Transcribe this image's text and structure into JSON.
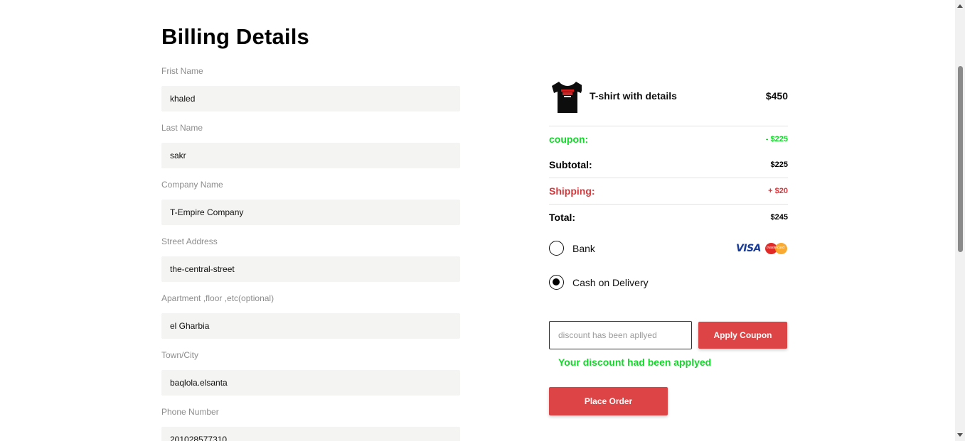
{
  "billing": {
    "title": "Billing Details",
    "fields": [
      {
        "label": "Frist Name",
        "value": "khaled"
      },
      {
        "label": "Last Name",
        "value": "sakr"
      },
      {
        "label": "Company Name",
        "value": "T-Empire Company"
      },
      {
        "label": "Street Address",
        "value": "the-central-street"
      },
      {
        "label": "Apartment ,floor ,etc(optional)",
        "value": "el Gharbia"
      },
      {
        "label": "Town/City",
        "value": "baqlola.elsanta"
      },
      {
        "label": "Phone Number",
        "value": "201028577310"
      }
    ]
  },
  "order": {
    "product": {
      "name": "T-shirt with details",
      "price": "$450",
      "image_icon": "tshirt-icon"
    },
    "coupon": {
      "label": "coupon:",
      "value": "- $225"
    },
    "subtotal": {
      "label": "Subtotal:",
      "value": "$225"
    },
    "shipping": {
      "label": "Shipping:",
      "value": "+ $20"
    },
    "total": {
      "label": "Total:",
      "value": "$245"
    }
  },
  "payment": {
    "bank_label": "Bank",
    "cash_label": "Cash on Delivery",
    "selected": "cash",
    "card_logos": [
      "VISA",
      "mastercard"
    ]
  },
  "coupon_form": {
    "placeholder": "discount has been apllyed",
    "value": "",
    "apply_label": "Apply Coupon",
    "message": "Your discount had been applyed"
  },
  "place_order_label": "Place Order",
  "colors": {
    "accent_red": "#dc4446",
    "success_green": "#15d62b",
    "input_bg": "#f4f4f2"
  }
}
